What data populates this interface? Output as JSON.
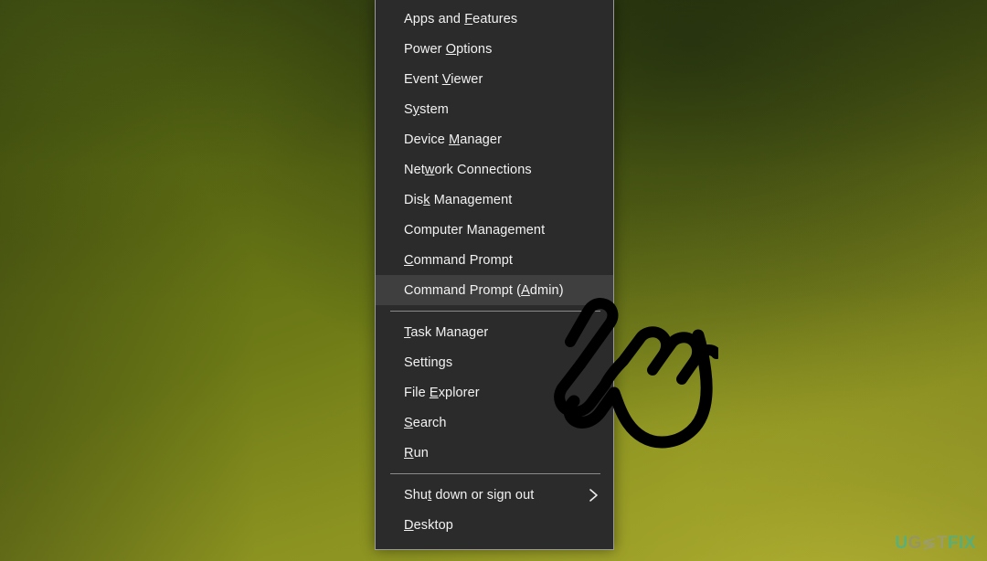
{
  "desktop": {
    "wallpaper_colors": {
      "dark_olive": "#4e5c12",
      "mid_olive": "#6d7a16",
      "bright_yellow_green": "#a5a62c",
      "shadow_green": "#1a2810"
    }
  },
  "winx_menu": {
    "background_color": "#2b2b2b",
    "border_color": "#9a9a9a",
    "text_color": "#f2f2f2",
    "highlight_color": "#3f3f3f",
    "separator_color": "#8a8a8a",
    "groups": [
      {
        "items": [
          {
            "label": "Apps and Features",
            "pre": "Apps and ",
            "accel": "F",
            "post": "eatures",
            "highlighted": false,
            "submenu": false
          },
          {
            "label": "Power Options",
            "pre": "Power ",
            "accel": "O",
            "post": "ptions",
            "highlighted": false,
            "submenu": false
          },
          {
            "label": "Event Viewer",
            "pre": "Event ",
            "accel": "V",
            "post": "iewer",
            "highlighted": false,
            "submenu": false
          },
          {
            "label": "System",
            "pre": "S",
            "accel": "y",
            "post": "stem",
            "highlighted": false,
            "submenu": false
          },
          {
            "label": "Device Manager",
            "pre": "Device ",
            "accel": "M",
            "post": "anager",
            "highlighted": false,
            "submenu": false
          },
          {
            "label": "Network Connections",
            "pre": "Net",
            "accel": "w",
            "post": "ork Connections",
            "highlighted": false,
            "submenu": false
          },
          {
            "label": "Disk Management",
            "pre": "Dis",
            "accel": "k",
            "post": " Management",
            "highlighted": false,
            "submenu": false
          },
          {
            "label": "Computer Management",
            "pre": "Computer Management",
            "accel": "",
            "post": "",
            "highlighted": false,
            "submenu": false
          },
          {
            "label": "Command Prompt",
            "pre": "",
            "accel": "C",
            "post": "ommand Prompt",
            "highlighted": false,
            "submenu": false
          },
          {
            "label": "Command Prompt (Admin)",
            "pre": "Command Prompt (",
            "accel": "A",
            "post": "dmin)",
            "highlighted": true,
            "submenu": false
          }
        ]
      },
      {
        "items": [
          {
            "label": "Task Manager",
            "pre": "",
            "accel": "T",
            "post": "ask Manager",
            "highlighted": false,
            "submenu": false
          },
          {
            "label": "Settings",
            "pre": "Settings",
            "accel": "",
            "post": "",
            "highlighted": false,
            "submenu": false
          },
          {
            "label": "File Explorer",
            "pre": "File ",
            "accel": "E",
            "post": "xplorer",
            "highlighted": false,
            "submenu": false
          },
          {
            "label": "Search",
            "pre": "",
            "accel": "S",
            "post": "earch",
            "highlighted": false,
            "submenu": false
          },
          {
            "label": "Run",
            "pre": "",
            "accel": "R",
            "post": "un",
            "highlighted": false,
            "submenu": false
          }
        ]
      },
      {
        "items": [
          {
            "label": "Shut down or sign out",
            "pre": "Shu",
            "accel": "t",
            "post": " down or sign out",
            "highlighted": false,
            "submenu": true
          },
          {
            "label": "Desktop",
            "pre": "",
            "accel": "D",
            "post": "esktop",
            "highlighted": false,
            "submenu": false
          }
        ]
      }
    ]
  },
  "cursor": {
    "type": "pointing-hand",
    "outline_color": "#000000"
  },
  "watermark": {
    "part_u": "U",
    "part_g": "G",
    "part_mark": "≶",
    "part_t": "T",
    "part_fix": "FIX",
    "accent_color": "#2fb8a8",
    "neutral_color": "#9a9a8c"
  }
}
